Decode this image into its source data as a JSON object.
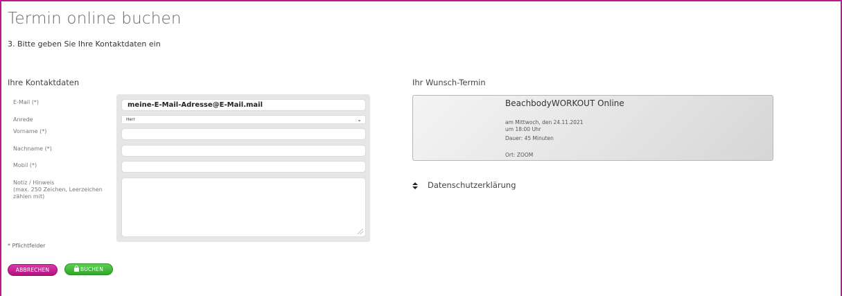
{
  "page": {
    "title": "Termin online buchen",
    "step": "3. Bitte geben Sie Ihre Kontaktdaten ein"
  },
  "contact": {
    "section_title": "Ihre Kontaktdaten",
    "fields": {
      "email": {
        "label": "E-Mail (*)",
        "value": "meine-E-Mail-Adresse@E-Mail.mail"
      },
      "salutation": {
        "label": "Anrede",
        "value": "Herr"
      },
      "firstname": {
        "label": "Vorname (*)",
        "value": ""
      },
      "lastname": {
        "label": "Nachname (*)",
        "value": ""
      },
      "mobile": {
        "label": "Mobil (*)",
        "value": ""
      },
      "note": {
        "label_line1": "Notiz / Hinweis",
        "label_line2": "(max. 250 Zeichen, Leerzeichen",
        "label_line3": "zählen mit)",
        "value": ""
      }
    },
    "required_note": "* Pflichtfelder"
  },
  "buttons": {
    "cancel": "ABBRECHEN",
    "book": "BUCHEN"
  },
  "appointment": {
    "section_title": "Ihr Wunsch-Termin",
    "name": "BeachbodyWORKOUT Online",
    "date": "am Mittwoch, den 24.11.2021",
    "time": "um 18:00 Uhr",
    "duration": "Dauer: 45 Minuten",
    "location": "Ort: ZOOM"
  },
  "privacy": {
    "label": "Datenschutzerklärung"
  },
  "icons": {
    "book_button": "lock-icon",
    "privacy_toggle": "sort-icon",
    "select": "chevron-down-icon"
  },
  "colors": {
    "frame_border": "#c1158f",
    "cancel_button": "#c41b8f",
    "book_button": "#3fb83a",
    "appointment_border": "#7ccbe8"
  }
}
